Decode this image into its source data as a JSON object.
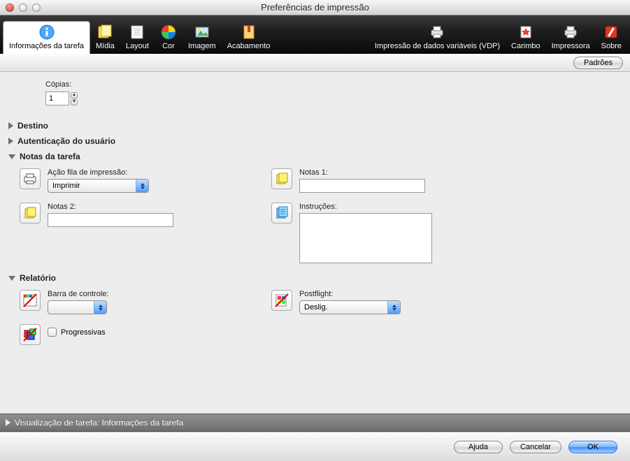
{
  "window": {
    "title": "Preferências de impressão"
  },
  "toolbar": {
    "items": [
      {
        "label": "Informações da tarefa"
      },
      {
        "label": "Mídia"
      },
      {
        "label": "Layout"
      },
      {
        "label": "Cor"
      },
      {
        "label": "Imagem"
      },
      {
        "label": "Acabamento"
      },
      {
        "label": "Impressão de dados variáveis (VDP)"
      },
      {
        "label": "Carimbo"
      },
      {
        "label": "Impressora"
      },
      {
        "label": "Sobre"
      }
    ]
  },
  "defaults_button": "Padrões",
  "copies": {
    "label": "Cópias:",
    "value": "1"
  },
  "sections": {
    "destino": "Destino",
    "auth": "Autenticação do usuário",
    "notas": "Notas da tarefa",
    "relatorio": "Relatório"
  },
  "notas": {
    "acao_label": "Ação fila de impressão:",
    "acao_value": "Imprimir",
    "notas1_label": "Notas 1:",
    "notas1_value": "",
    "notas2_label": "Notas 2:",
    "notas2_value": "",
    "instrucoes_label": "Instruções:",
    "instrucoes_value": ""
  },
  "relatorio": {
    "barra_label": "Barra de controle:",
    "barra_value": "",
    "postflight_label": "Postflight:",
    "postflight_value": "Deslig.",
    "progressivas_label": "Progressivas"
  },
  "preview_bar": "Visualização de tarefa: Informações da tarefa",
  "footer": {
    "help": "Ajuda",
    "cancel": "Cancelar",
    "ok": "OK"
  }
}
